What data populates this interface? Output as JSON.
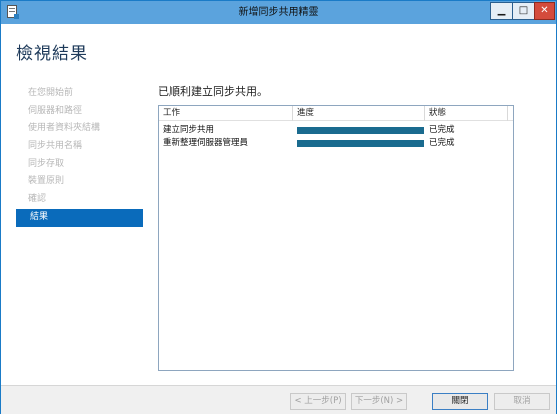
{
  "window": {
    "title": "新增同步共用精靈",
    "controls": {
      "minimize": "▁",
      "maximize": "□",
      "close": "✕"
    }
  },
  "page": {
    "title": "檢視結果",
    "result_message": "已順利建立同步共用。"
  },
  "nav": {
    "items": [
      {
        "label": "在您開始前",
        "state": "disabled"
      },
      {
        "label": "伺服器和路徑",
        "state": "disabled"
      },
      {
        "label": "使用者資料夾結構",
        "state": "disabled"
      },
      {
        "label": "同步共用名稱",
        "state": "disabled"
      },
      {
        "label": "同步存取",
        "state": "disabled"
      },
      {
        "label": "裝置原則",
        "state": "disabled"
      },
      {
        "label": "確認",
        "state": "disabled"
      },
      {
        "label": "結果",
        "state": "active"
      }
    ]
  },
  "table": {
    "columns": [
      "工作",
      "進度",
      "狀態"
    ],
    "rows": [
      {
        "task": "建立同步共用",
        "progress": 1.0,
        "status": "已完成"
      },
      {
        "task": "重新整理伺服器管理員",
        "progress": 1.0,
        "status": "已完成"
      }
    ]
  },
  "footer": {
    "prev": "< 上一步(P)",
    "next": "下一步(N) >",
    "close": "關閉",
    "cancel": "取消"
  },
  "colors": {
    "titlebar": "#5ba3dd",
    "nav_active": "#0a6bbb",
    "progress_fill": "#1a6b8f",
    "close_button": "#d44b3c"
  },
  "icons": {
    "app": "wizard-app-icon"
  }
}
